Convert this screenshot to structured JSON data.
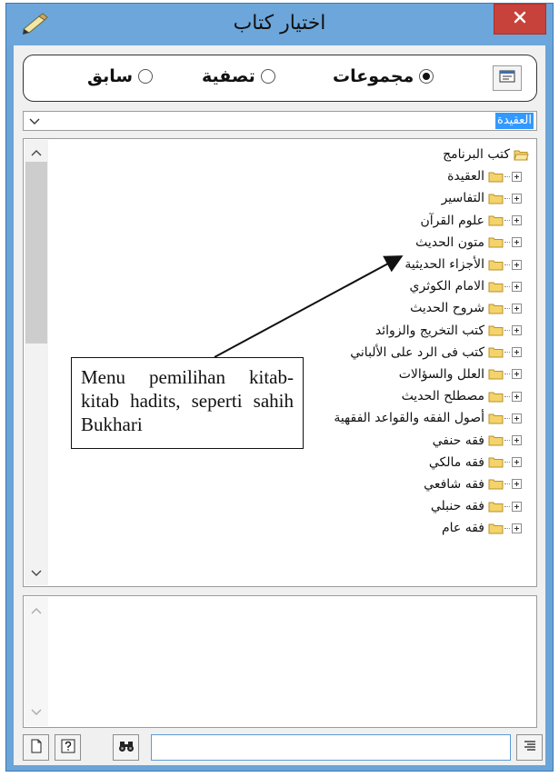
{
  "window": {
    "title": "اختيار كتاب",
    "close_label": "✕"
  },
  "mode": {
    "options": [
      {
        "label": "مجموعات",
        "selected": true
      },
      {
        "label": "تصفية",
        "selected": false
      },
      {
        "label": "سابق",
        "selected": false
      }
    ]
  },
  "category_select": {
    "value": "العقيدة"
  },
  "tree": {
    "root_label": "كتب البرنامج",
    "items": [
      "العقيدة",
      "التفاسير",
      "علوم القرآن",
      "متون الحديث",
      "الأجزاء الحديثية",
      "الامام الكوثري",
      "شروح الحديث",
      "كتب التخريج والزوائد",
      "كتب فى الرد على الألباني",
      "العلل والسؤالات",
      "مصطلح الحديث",
      "أصول الفقه والقواعد الفقهية",
      "فقه حنفي",
      "فقه مالكي",
      "فقه شافعي",
      "فقه حنبلي",
      "فقه عام"
    ]
  },
  "annotation": {
    "text": "Menu pemilihan kitab-kitab hadits, seperti sahih Bukhari"
  },
  "search": {
    "value": ""
  },
  "icons": {
    "title": "pencil-icon",
    "close": "close-icon",
    "toggle_view": "window-icon",
    "new_page": "page-icon",
    "help": "help-icon",
    "find": "binoculars-icon",
    "list": "list-icon",
    "folder": "folder-icon",
    "open_folder": "open-folder-icon"
  },
  "colors": {
    "titlebar": "#6ca6da",
    "close": "#c7423a",
    "selection": "#3399ff",
    "folder": "#f5d36b"
  }
}
